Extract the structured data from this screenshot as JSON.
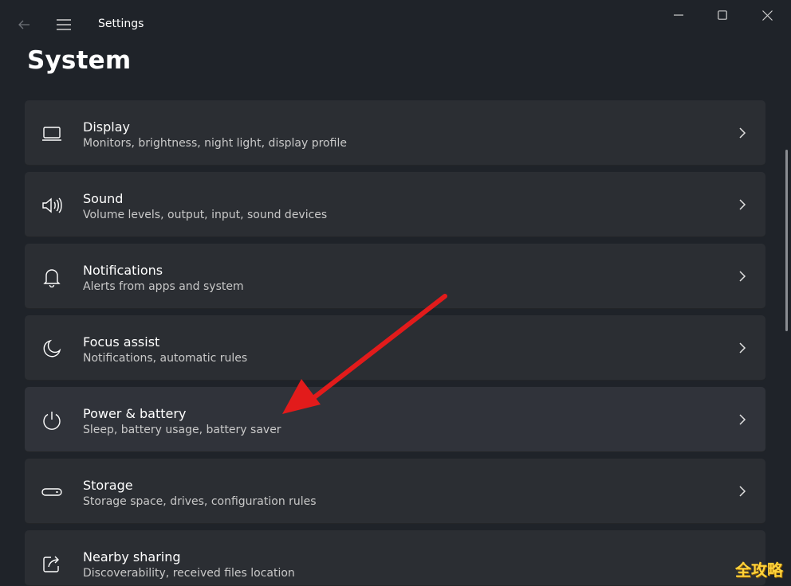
{
  "window": {
    "app_title": "Settings",
    "icons": {
      "back": "back-arrow-icon",
      "menu": "hamburger-menu-icon",
      "minimize": "minimize-icon",
      "maximize": "maximize-icon",
      "close": "close-icon"
    }
  },
  "page": {
    "title": "System"
  },
  "items": [
    {
      "title": "Display",
      "subtitle": "Monitors, brightness, night light, display profile",
      "icon": "laptop-display-icon"
    },
    {
      "title": "Sound",
      "subtitle": "Volume levels, output, input, sound devices",
      "icon": "speaker-icon"
    },
    {
      "title": "Notifications",
      "subtitle": "Alerts from apps and system",
      "icon": "bell-icon"
    },
    {
      "title": "Focus assist",
      "subtitle": "Notifications, automatic rules",
      "icon": "moon-icon"
    },
    {
      "title": "Power & battery",
      "subtitle": "Sleep, battery usage, battery saver",
      "icon": "power-icon"
    },
    {
      "title": "Storage",
      "subtitle": "Storage space, drives, configuration rules",
      "icon": "storage-drive-icon"
    },
    {
      "title": "Nearby sharing",
      "subtitle": "Discoverability, received files location",
      "icon": "share-icon"
    }
  ],
  "annotation": {
    "arrow_color": "#e21b1b"
  },
  "watermark": {
    "text": "全攻略"
  }
}
